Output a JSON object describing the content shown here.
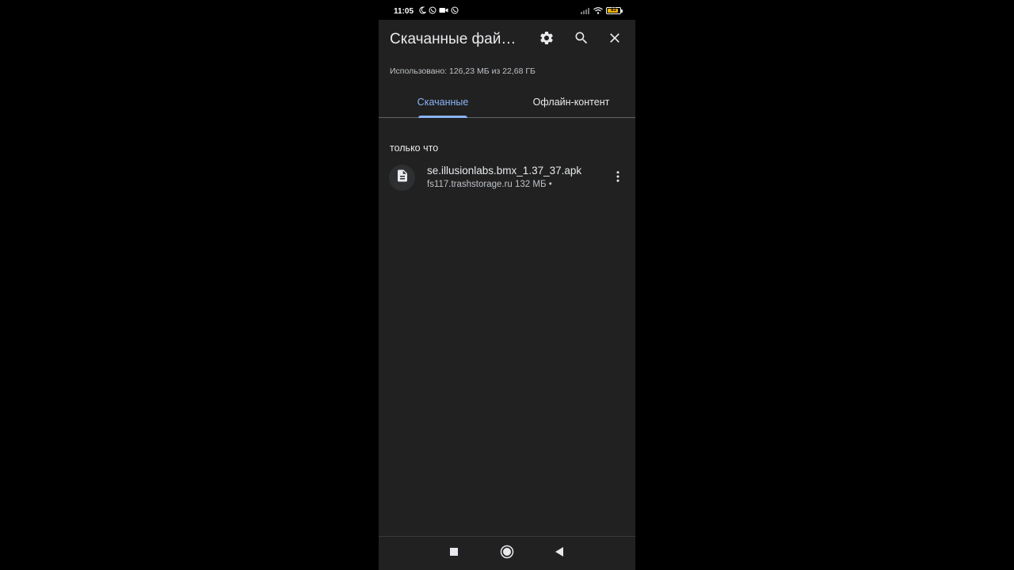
{
  "status_bar": {
    "time": "11:05",
    "battery_level": "83",
    "left_icons": [
      "moon-icon",
      "viber-icon",
      "video-camera-icon",
      "viber-icon"
    ],
    "right_icons": [
      "signal-icon",
      "wifi-icon",
      "battery-icon"
    ]
  },
  "app_bar": {
    "title": "Скачанные фай…",
    "actions": [
      "gear-icon",
      "search-icon",
      "close-icon"
    ]
  },
  "storage": {
    "text": "Использовано: 126,23 МБ из 22,68 ГБ"
  },
  "tabs": [
    {
      "label": "Скачанные",
      "selected": true
    },
    {
      "label": "Офлайн-контент",
      "selected": false
    }
  ],
  "sections": [
    {
      "title": "только что",
      "items": [
        {
          "icon": "file-icon",
          "name": "se.illusionlabs.bmx_1.37_37.apk",
          "meta": "fs117.trashstorage.ru 132 МБ •"
        }
      ]
    }
  ],
  "nav_bar": {
    "buttons": [
      "recents-icon",
      "home-icon",
      "back-icon"
    ]
  },
  "colors": {
    "background": "#212121",
    "accent": "#8ab4f8",
    "text_primary": "#e8eaed",
    "text_secondary": "#bdc1c6",
    "battery": "#f0b400"
  }
}
